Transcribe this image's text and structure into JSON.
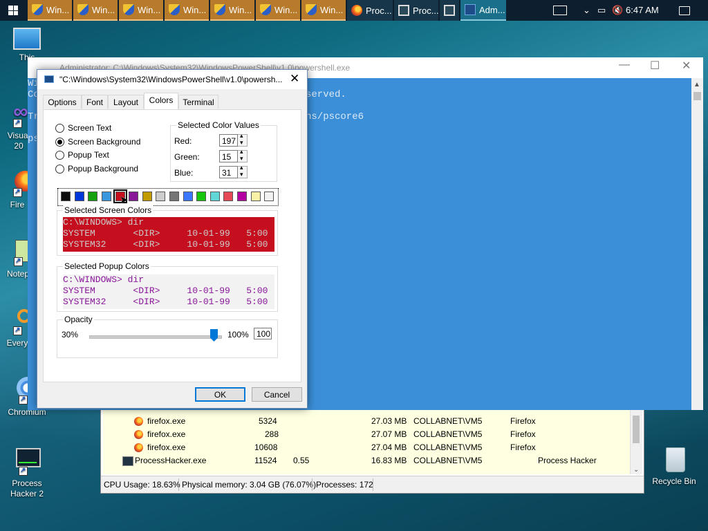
{
  "taskbar": {
    "items": [
      {
        "label": "Win...",
        "icon": "uac-shield-icon"
      },
      {
        "label": "Win...",
        "icon": "uac-shield-icon"
      },
      {
        "label": "Win...",
        "icon": "uac-shield-icon"
      },
      {
        "label": "Win...",
        "icon": "uac-shield-icon"
      },
      {
        "label": "Win...",
        "icon": "uac-shield-icon"
      },
      {
        "label": "Win...",
        "icon": "uac-shield-icon"
      },
      {
        "label": "Win...",
        "icon": "uac-shield-icon"
      },
      {
        "label": "Proc...",
        "icon": "firefox-icon"
      },
      {
        "label": "Proc...",
        "icon": "process-hacker-icon"
      },
      {
        "label": "",
        "icon": "process-hacker-icon"
      },
      {
        "label": "Adm...",
        "icon": "powershell-icon"
      }
    ],
    "clock": "6:47 AM"
  },
  "desktop": {
    "icons": [
      {
        "label": "This"
      },
      {
        "label": "Visual\n20"
      },
      {
        "label": "Fire"
      },
      {
        "label": "Notep"
      },
      {
        "label": "Every"
      },
      {
        "label": "Chromium"
      },
      {
        "label": "Process\nHacker 2"
      },
      {
        "label": "Recycle Bin"
      }
    ]
  },
  "powershell_window": {
    "title": "Administrator: C:\\Windows\\System32\\WindowsPowerShell\\v1.0\\powershell.exe",
    "lines": [
      {
        "text": "Wi"
      },
      {
        "text": "Co"
      },
      {
        "text": "served."
      },
      {
        "text": "Tr"
      },
      {
        "text": "ps"
      },
      {
        "text": "ns/pscore6"
      }
    ]
  },
  "process_hacker": {
    "rows": [
      {
        "name": "firefox.exe",
        "pid": "5324",
        "cpu": "",
        "mem": "27.03 MB",
        "user": "COLLABNET\\VM5",
        "desc": "Firefox"
      },
      {
        "name": "firefox.exe",
        "pid": "288",
        "cpu": "",
        "mem": "27.07 MB",
        "user": "COLLABNET\\VM5",
        "desc": "Firefox"
      },
      {
        "name": "firefox.exe",
        "pid": "10608",
        "cpu": "",
        "mem": "27.04 MB",
        "user": "COLLABNET\\VM5",
        "desc": "Firefox"
      },
      {
        "name": "ProcessHacker.exe",
        "pid": "11524",
        "cpu": "0.55",
        "mem": "16.83 MB",
        "user": "COLLABNET\\VM5",
        "desc": "Process Hacker"
      }
    ],
    "status": {
      "cpu": "CPU Usage: 18.63%",
      "memory": "Physical memory: 3.04 GB (76.07%)",
      "processes": "Processes: 172"
    }
  },
  "dialog": {
    "title": "\"C:\\Windows\\System32\\WindowsPowerShell\\v1.0\\powersh...",
    "tabs": [
      "Options",
      "Font",
      "Layout",
      "Colors",
      "Terminal"
    ],
    "active_tab": "Colors",
    "radios": [
      {
        "label": "Screen Text",
        "checked": false
      },
      {
        "label": "Screen Background",
        "checked": true
      },
      {
        "label": "Popup Text",
        "checked": false
      },
      {
        "label": "Popup Background",
        "checked": false
      }
    ],
    "color_values": {
      "legend": "Selected Color Values",
      "red_label": "Red:",
      "red": "197",
      "green_label": "Green:",
      "green": "15",
      "blue_label": "Blue:",
      "blue": "31"
    },
    "palette": [
      "#0c0c0c",
      "#0037da",
      "#13a10e",
      "#3a96dd",
      "#c50f1f",
      "#881798",
      "#c19c00",
      "#cccccc",
      "#767676",
      "#3b78ff",
      "#16c60c",
      "#61d6d6",
      "#e74856",
      "#b4009e",
      "#f9f1a5",
      "#f2f2f2"
    ],
    "selected_palette_index": 4,
    "screen_colors": {
      "legend": "Selected Screen Colors",
      "bg": "#c50f1f",
      "fg": "#cccccc",
      "lines": [
        "C:\\WINDOWS> dir",
        "SYSTEM       <DIR>     10-01-99   5:00",
        "SYSTEM32     <DIR>     10-01-99   5:00"
      ]
    },
    "popup_colors": {
      "legend": "Selected Popup Colors",
      "bg": "#f2f2f2",
      "fg": "#881798",
      "lines": [
        "C:\\WINDOWS> dir",
        "SYSTEM       <DIR>     10-01-99   5:00",
        "SYSTEM32     <DIR>     10-01-99   5:00"
      ]
    },
    "opacity": {
      "legend": "Opacity",
      "min": "30%",
      "max": "100%",
      "value": "100"
    },
    "ok_label": "OK",
    "cancel_label": "Cancel"
  }
}
